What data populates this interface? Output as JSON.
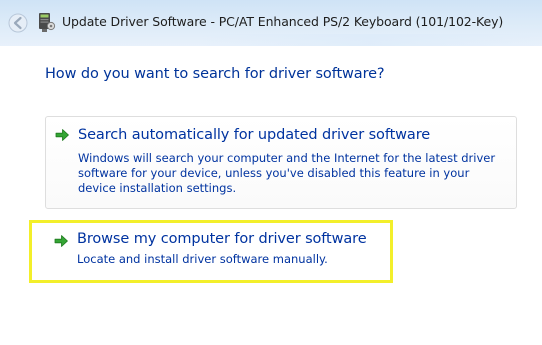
{
  "window": {
    "title": "Update Driver Software - PC/AT Enhanced PS/2 Keyboard (101/102-Key)"
  },
  "heading": "How do you want to search for driver software?",
  "options": [
    {
      "title": "Search automatically for updated driver software",
      "description": "Windows will search your computer and the Internet for the latest driver software for your device, unless you've disabled this feature in your device installation settings.",
      "icon": "green-arrow-icon"
    },
    {
      "title": "Browse my computer for driver software",
      "description": "Locate and install driver software manually.",
      "icon": "green-arrow-icon"
    }
  ],
  "colors": {
    "link_blue": "#0033a0",
    "heading_blue": "#003399",
    "highlight_yellow": "#f3ef2a",
    "arrow_green": "#2e9e2e"
  }
}
